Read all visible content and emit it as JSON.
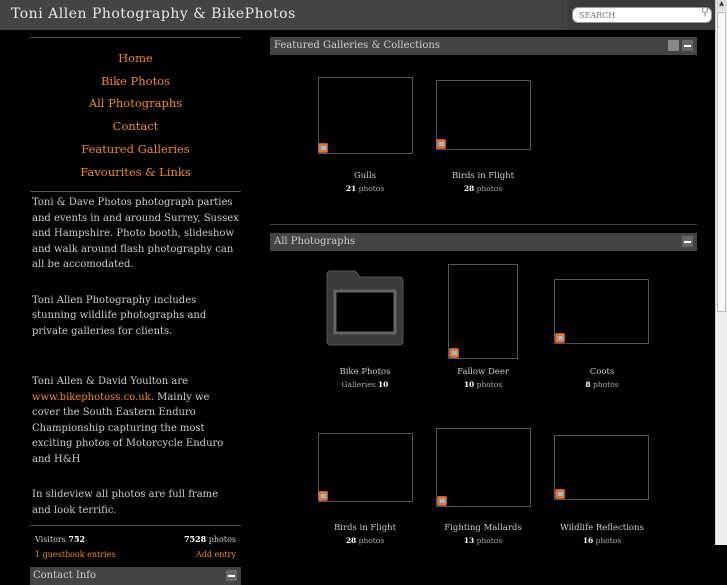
{
  "header": {
    "title": "Toni Allen Photography & BikePhotos",
    "search_placeholder": "SEARCH"
  },
  "nav": [
    {
      "label": "Home"
    },
    {
      "label": "Bike Photos"
    },
    {
      "label": "All Photographs"
    },
    {
      "label": "Contact"
    },
    {
      "label": "Featured Galleries"
    },
    {
      "label": "Favourites & Links"
    }
  ],
  "description": {
    "p1": "Toni & Dave Photos photograph parties and events in and around Surrey, Sussex and Hampshire. Photo booth, slideshow and walk around flash photography can all be accomodated.",
    "p2": "Toni Allen Photography includes stunning wildlife photographs and private galleries for clients.",
    "p3_pre": "Toni Allen & David Youlton are ",
    "p3_link": "www.bikephotoss.co.uk",
    "p3_post": ". Mainly we cover the South Eastern Enduro Championship capturing the most exciting photos of Motorcycle Enduro and H&H",
    "p4": "In slideview all photos are full frame and look terrific."
  },
  "stats": {
    "visitors_label": "Visitors",
    "visitors": "752",
    "photos": "7528",
    "photos_label": "photos",
    "guestbook": "1 guestbook entries",
    "add_entry": "Add entry"
  },
  "contact": {
    "title": "Contact Info"
  },
  "featured": {
    "title": "Featured Galleries & Collections",
    "items": [
      {
        "name": "Gulls",
        "count": "21",
        "unit": "photos"
      },
      {
        "name": "Birds in Flight",
        "count": "28",
        "unit": "photos"
      }
    ]
  },
  "all": {
    "title": "All Photographs",
    "items": [
      {
        "name": "Bike Photos",
        "count_label": "Galleries",
        "count": "10"
      },
      {
        "name": "Fallow Deer",
        "count": "10",
        "unit": "photos"
      },
      {
        "name": "Coots",
        "count": "8",
        "unit": "photos"
      },
      {
        "name": "Birds in Flight",
        "count": "28",
        "unit": "photos"
      },
      {
        "name": "Fighting Mallards",
        "count": "13",
        "unit": "photos"
      },
      {
        "name": "Wildlife Reflections",
        "count": "16",
        "unit": "photos"
      }
    ]
  },
  "colors": {
    "accent": "#f08a1a",
    "header_bg": "#444444",
    "background": "#000000"
  }
}
